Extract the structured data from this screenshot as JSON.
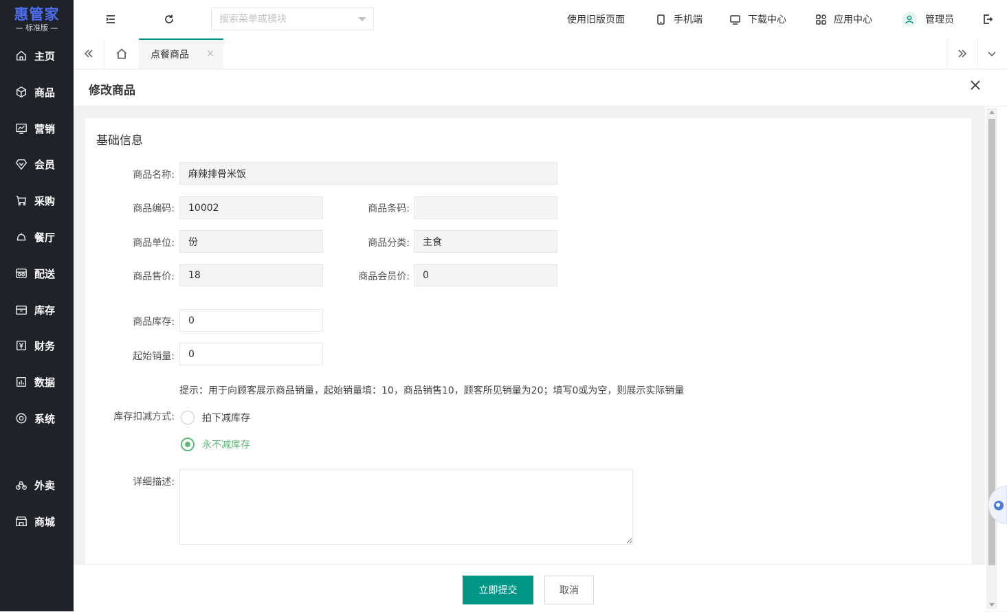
{
  "logo": {
    "title": "惠管家",
    "subtitle": "— 标准版 —",
    "brand_color": "#4c6ef5"
  },
  "sidebar": {
    "items": [
      {
        "label": "主页",
        "icon": "home-icon"
      },
      {
        "label": "商品",
        "icon": "box-icon"
      },
      {
        "label": "营销",
        "icon": "chart-icon"
      },
      {
        "label": "会员",
        "icon": "diamond-icon"
      },
      {
        "label": "采购",
        "icon": "cart-icon"
      },
      {
        "label": "餐厅",
        "icon": "bell-icon"
      },
      {
        "label": "配送",
        "icon": "delivery-icon"
      },
      {
        "label": "库存",
        "icon": "archive-icon"
      },
      {
        "label": "财务",
        "icon": "yen-icon"
      },
      {
        "label": "数据",
        "icon": "bar-chart-icon"
      },
      {
        "label": "系统",
        "icon": "gear-icon"
      },
      {
        "label": "外卖",
        "icon": "scooter-icon"
      },
      {
        "label": "商城",
        "icon": "shop-icon"
      }
    ]
  },
  "topbar": {
    "search_placeholder": "搜索菜单或模块",
    "old_page": "使用旧版页面",
    "mobile": "手机端",
    "download": "下载中心",
    "apps": "应用中心",
    "user": "管理员"
  },
  "tabs": {
    "active": "点餐商品",
    "close": "×"
  },
  "panel": {
    "title": "修改商品"
  },
  "form": {
    "section": "基础信息",
    "name_label": "商品名称:",
    "name_value": "麻辣排骨米饭",
    "code_label": "商品编码:",
    "code_value": "10002",
    "barcode_label": "商品条码:",
    "barcode_value": "",
    "unit_label": "商品单位:",
    "unit_value": "份",
    "category_label": "商品分类:",
    "category_value": "主食",
    "price_label": "商品售价:",
    "price_value": "18",
    "member_price_label": "商品会员价:",
    "member_price_value": "0",
    "stock_label": "商品库存:",
    "stock_value": "0",
    "initial_sales_label": "起始销量:",
    "initial_sales_value": "0",
    "hint": "提示：用于向顾客展示商品销量，起始销量填：10，商品销售10，顾客所见销量为20；填写0或为空，则展示实际销量",
    "deduct_label": "库存扣减方式:",
    "deduct_options": [
      "拍下减库存",
      "永不减库存"
    ],
    "deduct_selected": "永不减库存",
    "desc_label": "详细描述:"
  },
  "footer": {
    "submit": "立即提交",
    "cancel": "取消"
  },
  "colors": {
    "primary": "#009688",
    "radio_checked": "#5fb878",
    "sidebar_bg": "#20222a"
  }
}
